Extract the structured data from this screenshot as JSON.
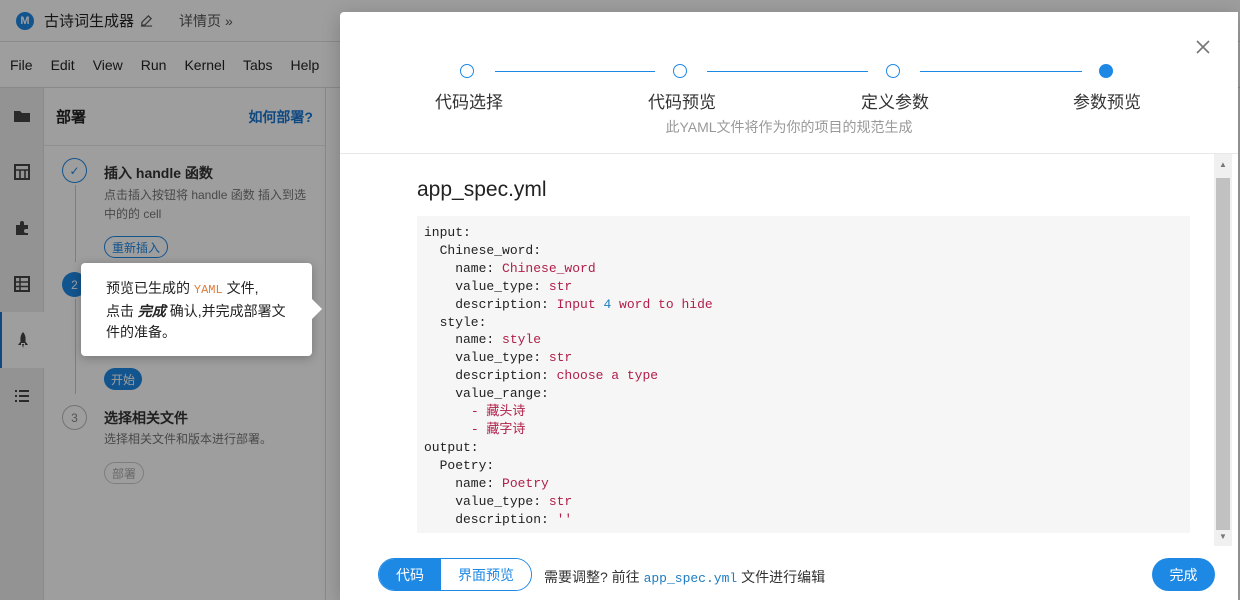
{
  "header": {
    "app_title": "古诗词生成器",
    "logo_letter": "M",
    "detail_link": "详情页",
    "detail_chevron": "»"
  },
  "menubar": {
    "items": [
      "File",
      "Edit",
      "View",
      "Run",
      "Kernel",
      "Tabs",
      "Help"
    ]
  },
  "deploy": {
    "title": "部署",
    "help_link": "如何部署?",
    "steps": [
      {
        "number": "✓",
        "title": "插入 handle 函数",
        "desc": "点击插入按钮将 handle 函数 插入到选中的的 cell",
        "button": "重新插入"
      },
      {
        "number": "2",
        "button": "开始"
      },
      {
        "number": "3",
        "title": "选择相关文件",
        "desc": "选择相关文件和版本进行部署。",
        "button": "部署"
      }
    ]
  },
  "tooltip": {
    "line1_pre": "预览已生成的 ",
    "line1_code": "YAML",
    "line1_post": " 文件,",
    "line2_pre": "点击 ",
    "line2_em": "完成",
    "line2_post": " 确认,并完成部署文件的准备。"
  },
  "modal": {
    "wizard": {
      "steps": [
        "代码选择",
        "代码预览",
        "定义参数",
        "参数预览"
      ],
      "active_index": 3,
      "subtitle": "此YAML文件将作为你的项目的规范生成"
    },
    "file_title": "app_spec.yml",
    "code_lines": [
      {
        "text": "input:"
      },
      {
        "text": "  Chinese_word:"
      },
      {
        "key": "    name: ",
        "val": "Chinese_word"
      },
      {
        "key": "    value_type: ",
        "val": "str"
      },
      {
        "key": "    description: ",
        "val": "Input ",
        "num": "4",
        "val2": " word to hide"
      },
      {
        "text": "  style:"
      },
      {
        "key": "    name: ",
        "val": "style"
      },
      {
        "key": "    value_type: ",
        "val": "str"
      },
      {
        "key": "    description: ",
        "val": "choose a type"
      },
      {
        "text": "    value_range:"
      },
      {
        "key": "      ",
        "val": "- 藏头诗"
      },
      {
        "key": "      ",
        "val": "- 藏字诗"
      },
      {
        "text": "output:"
      },
      {
        "text": "  Poetry:"
      },
      {
        "key": "    name: ",
        "val": "Poetry"
      },
      {
        "key": "    value_type: ",
        "val": "str"
      },
      {
        "key": "    description: ",
        "val": "''"
      }
    ],
    "footer": {
      "toggle_code": "代码",
      "toggle_ui": "界面预览",
      "hint_pre": "需要调整? 前往 ",
      "hint_file": "app_spec.yml",
      "hint_post": " 文件进行编辑",
      "done": "完成"
    }
  },
  "colors": {
    "accent": "#1e88e5",
    "code_value": "#b0204a",
    "code_number": "#1d7dc1"
  }
}
